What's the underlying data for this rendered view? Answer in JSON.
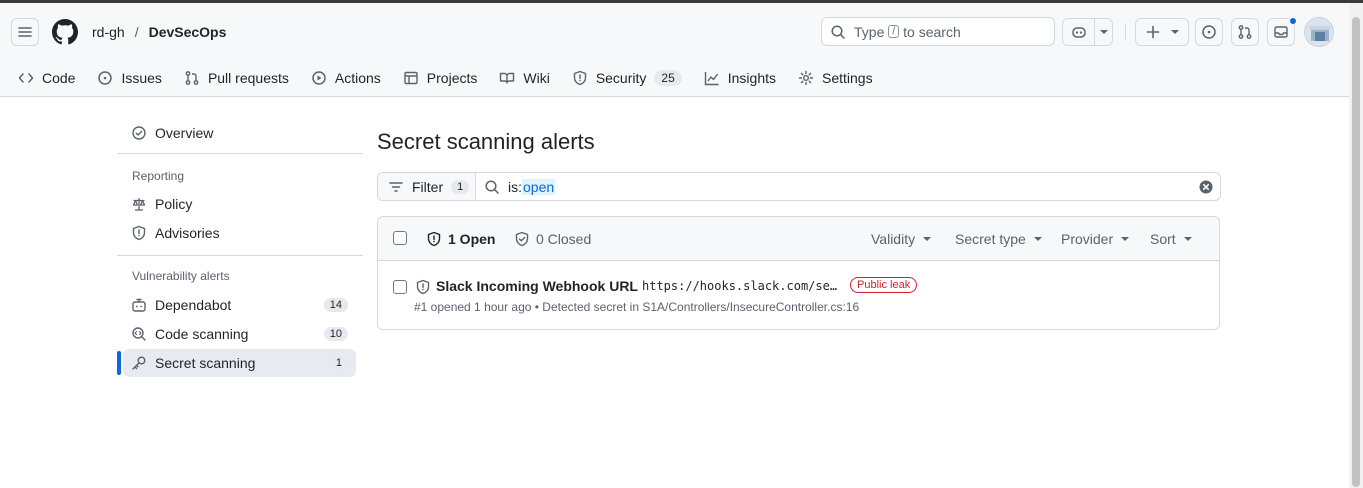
{
  "header": {
    "owner": "rd-gh",
    "separator": "/",
    "repo": "DevSecOps",
    "search": {
      "prefix": "Type",
      "key": "/",
      "suffix": "to search"
    }
  },
  "tabs": [
    {
      "label": "Code",
      "icon": "code-icon"
    },
    {
      "label": "Issues",
      "icon": "issue-icon"
    },
    {
      "label": "Pull requests",
      "icon": "pull-request-icon"
    },
    {
      "label": "Actions",
      "icon": "play-icon"
    },
    {
      "label": "Projects",
      "icon": "table-icon"
    },
    {
      "label": "Wiki",
      "icon": "book-icon"
    },
    {
      "label": "Security",
      "icon": "shield-icon",
      "count": "25"
    },
    {
      "label": "Insights",
      "icon": "graph-icon"
    },
    {
      "label": "Settings",
      "icon": "gear-icon"
    }
  ],
  "sidebar": {
    "overview": "Overview",
    "reporting_heading": "Reporting",
    "policy": "Policy",
    "advisories": "Advisories",
    "vuln_heading": "Vulnerability alerts",
    "items": [
      {
        "label": "Dependabot",
        "count": "14"
      },
      {
        "label": "Code scanning",
        "count": "10"
      },
      {
        "label": "Secret scanning",
        "count": "1"
      }
    ]
  },
  "main": {
    "title": "Secret scanning alerts",
    "filter_label": "Filter",
    "filter_count": "1",
    "query_key": "is:",
    "query_value": "open",
    "open_label": "1 Open",
    "closed_label": "0 Closed",
    "sorts": [
      "Validity",
      "Secret type",
      "Provider",
      "Sort"
    ],
    "alert": {
      "title": "Slack Incoming Webhook URL",
      "secret": "https://hooks.slack.com/services/",
      "badge": "Public leak",
      "meta": "#1 opened 1 hour ago • Detected secret in S1A/Controllers/InsecureController.cs:16"
    }
  },
  "colors": {
    "accent": "#0969da",
    "danger": "#cf222e",
    "muted": "#59636e"
  }
}
